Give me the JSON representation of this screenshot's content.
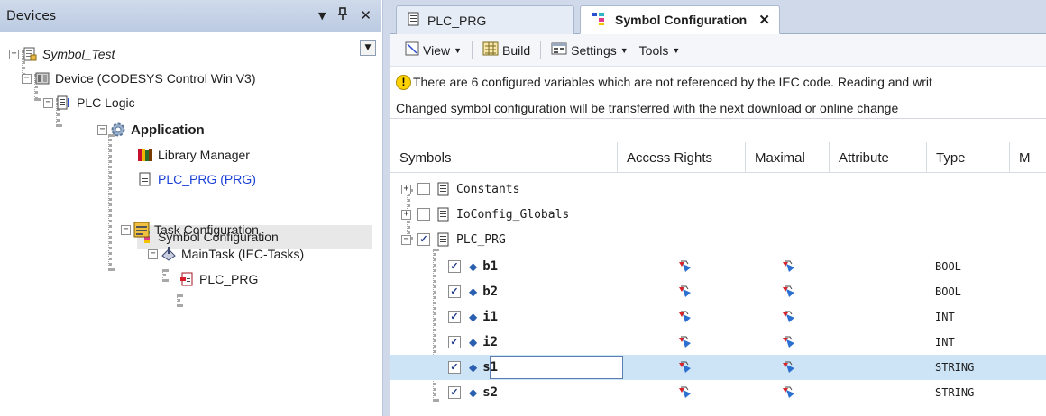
{
  "devices_panel": {
    "title": "Devices",
    "tree": {
      "project": "Symbol_Test",
      "device": "Device (CODESYS Control Win V3)",
      "plc_logic": "PLC Logic",
      "application": "Application",
      "library_manager": "Library Manager",
      "plc_prg": "PLC_PRG (PRG)",
      "symbol_configuration": "Symbol Configuration",
      "task_configuration": "Task Configuration",
      "main_task": "MainTask (IEC-Tasks)",
      "task_plc_prg": "PLC_PRG"
    }
  },
  "tabs": [
    {
      "label": "PLC_PRG",
      "active": false
    },
    {
      "label": "Symbol Configuration",
      "active": true
    }
  ],
  "toolbar": {
    "view": "View",
    "build": "Build",
    "settings": "Settings",
    "tools": "Tools"
  },
  "info": {
    "warning": "There are 6 configured variables which are not referenced by the IEC code. Reading and writ",
    "changed": "Changed symbol configuration will be transferred with the next download or online change"
  },
  "grid": {
    "columns": [
      "Symbols",
      "Access Rights",
      "Maximal",
      "Attribute",
      "Type",
      "M"
    ],
    "groups": [
      {
        "name": "Constants",
        "checked": false,
        "expanded": false
      },
      {
        "name": "IoConfig_Globals",
        "checked": false,
        "expanded": false
      },
      {
        "name": "PLC_PRG",
        "checked": true,
        "expanded": true
      }
    ],
    "variables": [
      {
        "name": "b1",
        "type": "BOOL",
        "checked": true
      },
      {
        "name": "b2",
        "type": "BOOL",
        "checked": true
      },
      {
        "name": "i1",
        "type": "INT",
        "checked": true
      },
      {
        "name": "i2",
        "type": "INT",
        "checked": true
      },
      {
        "name": "s1",
        "type": "STRING",
        "checked": true,
        "selected": true
      },
      {
        "name": "s2",
        "type": "STRING",
        "checked": true
      }
    ]
  },
  "colors": {
    "selection": "#cde4f7",
    "accent_blue": "#2b4fd0",
    "link_blue": "#1a3fd6",
    "panel_header": "#c8d4e8"
  }
}
